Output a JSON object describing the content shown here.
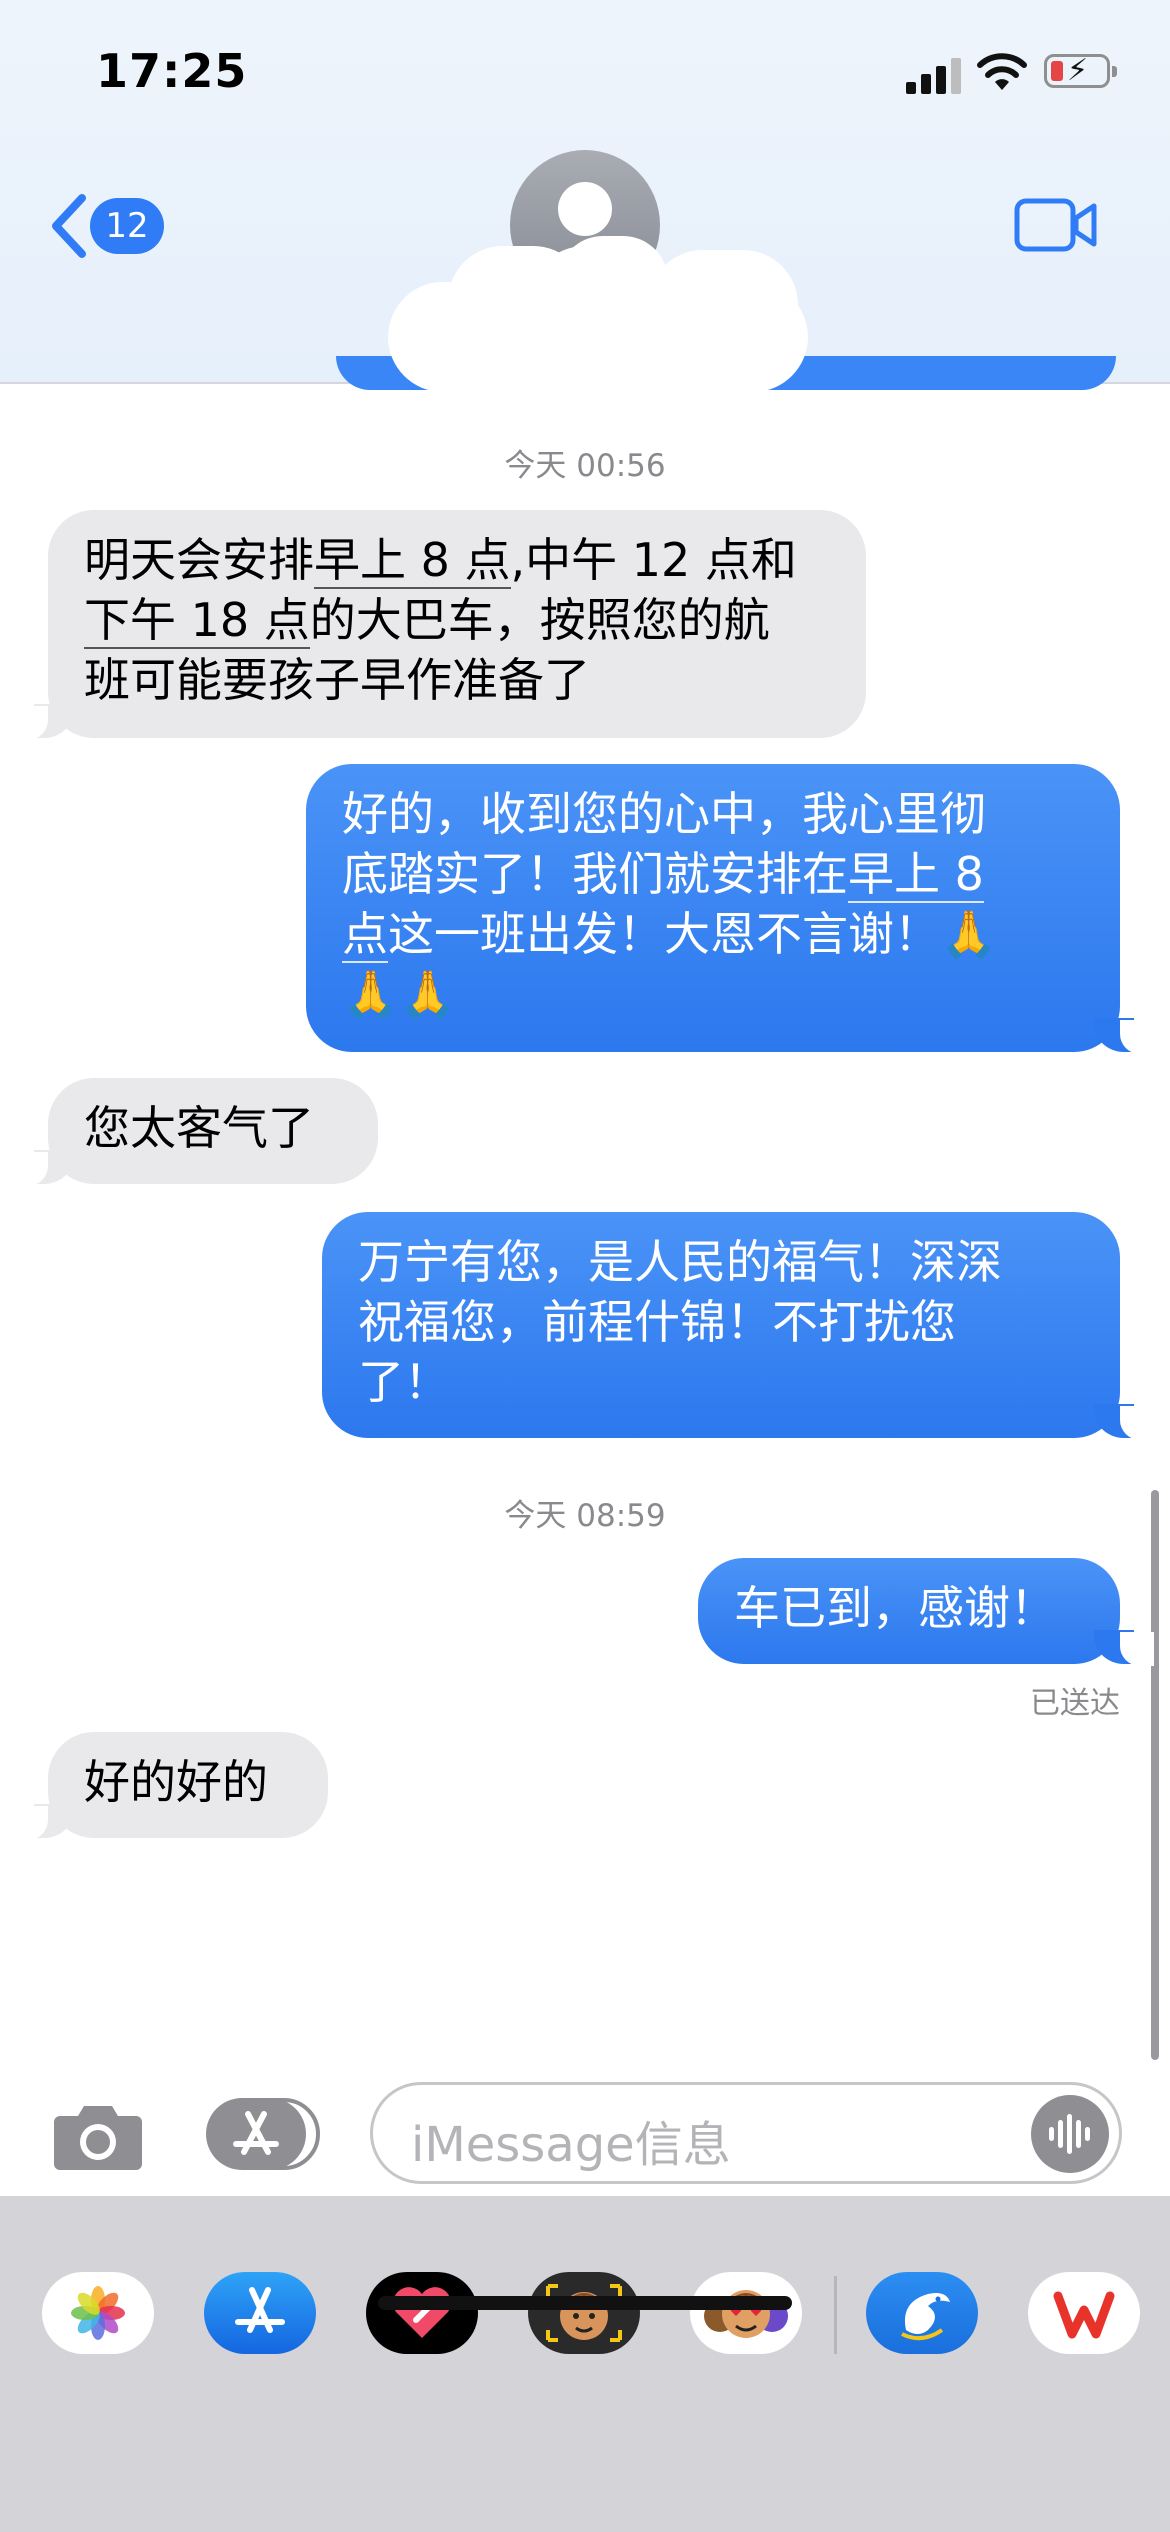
{
  "status_bar": {
    "time": "17:25"
  },
  "header": {
    "back_count": "12"
  },
  "messages": [
    {
      "type": "timestamp",
      "text": "今天 00:56"
    },
    {
      "type": "received",
      "line1_a": "明天会安排",
      "line1_b": "早上 8 点",
      "line1_c": ",中午 12 点和",
      "line2_a": "下午 18 点",
      "line2_b": "的大巴车，按照您的航",
      "line3": "班可能要孩子早作准备了"
    },
    {
      "type": "sent",
      "line1": "好的，收到您的心中，我心里彻",
      "line2_a": "底踏实了！我们就安排在",
      "line2_b": "早上 8",
      "line3_a": "点",
      "line3_b": "这一班出发！大恩不言谢！🙏",
      "line4": "🙏🙏"
    },
    {
      "type": "received",
      "text": "您太客气了"
    },
    {
      "type": "sent",
      "line1": "万宁有您，是人民的福气！深深",
      "line2": "祝福您，前程什锦！不打扰您",
      "line3": "了！"
    },
    {
      "type": "timestamp",
      "text": "今天 08:59"
    },
    {
      "type": "sent",
      "text": "车已到，感谢！"
    },
    {
      "type": "received",
      "text": "好的好的"
    }
  ],
  "delivered_label": "已送达",
  "input": {
    "placeholder": "iMessage信息"
  },
  "app_drawer": [
    "photos-app",
    "app-store-app",
    "digital-touch-app",
    "memoji-app",
    "memoji-stickers-app",
    "ctrip-app",
    "wps-office-app"
  ]
}
